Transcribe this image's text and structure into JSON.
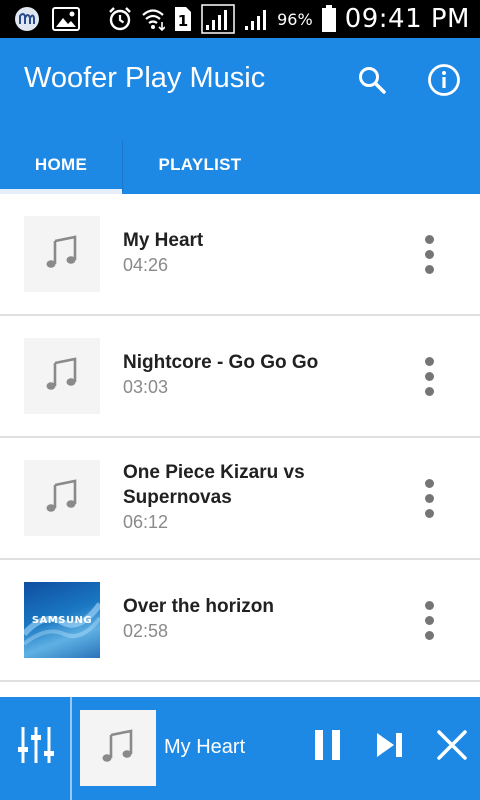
{
  "status_bar": {
    "sim": "1",
    "battery": "96%",
    "time": "09:41 PM"
  },
  "app_bar": {
    "title": "Woofer Play Music",
    "icons": [
      "search-icon",
      "info-icon"
    ],
    "tabs": [
      {
        "label": "HOME",
        "selected": true
      },
      {
        "label": "PLAYLIST",
        "selected": false
      }
    ],
    "color": "#1e88e5"
  },
  "songs": [
    {
      "title": "My Heart",
      "duration": "04:26",
      "artwork": "music-note-icon"
    },
    {
      "title": "Nightcore - Go Go Go",
      "duration": "03:03",
      "artwork": "music-note-icon"
    },
    {
      "title": "One Piece Kizaru vs Supernovas",
      "duration": "06:12",
      "artwork": "music-note-icon"
    },
    {
      "title": "Over the horizon",
      "duration": "02:58",
      "artwork": "samsung-album-art",
      "art_label": "SAMSUNG"
    }
  ],
  "now_playing": {
    "title": "My Heart",
    "icons": [
      "equalizer-icon",
      "pause-icon",
      "skip-next-icon",
      "close-icon"
    ]
  }
}
